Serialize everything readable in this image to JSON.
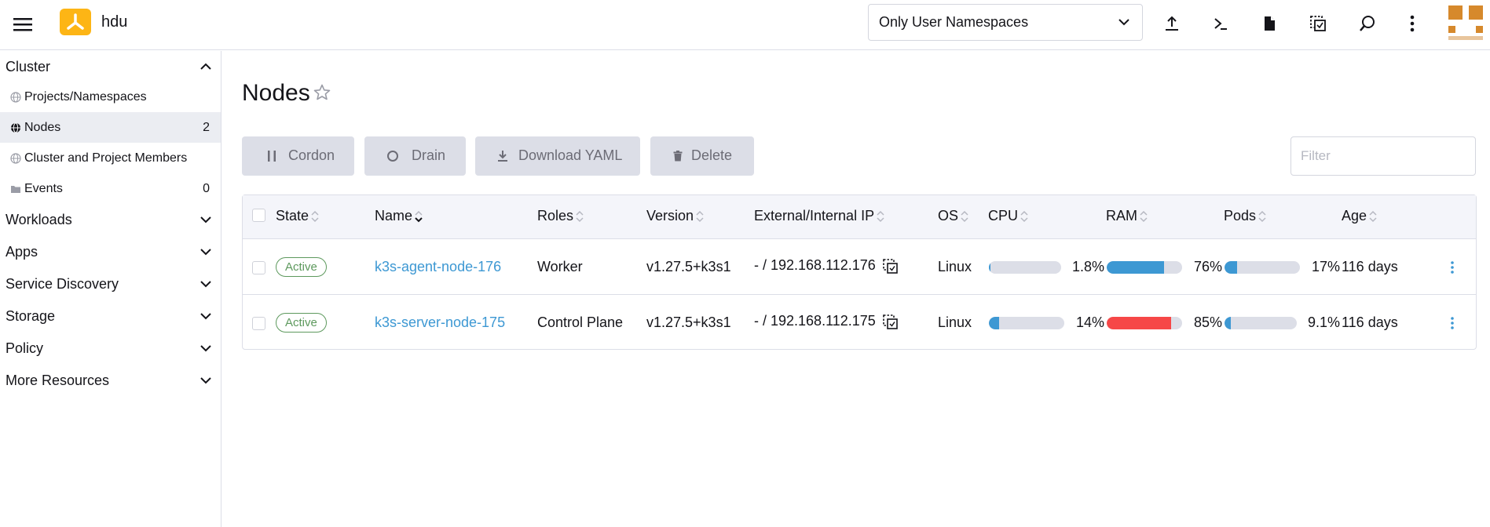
{
  "header": {
    "cluster_name": "hdu",
    "namespace_select": "Only User Namespaces"
  },
  "sidebar": {
    "groups": [
      {
        "label": "Cluster"
      },
      {
        "label": "Workloads"
      },
      {
        "label": "Apps"
      },
      {
        "label": "Service Discovery"
      },
      {
        "label": "Storage"
      },
      {
        "label": "Policy"
      },
      {
        "label": "More Resources"
      }
    ],
    "items": [
      {
        "label": "Projects/Namespaces",
        "count": ""
      },
      {
        "label": "Nodes",
        "count": "2"
      },
      {
        "label": "Cluster and Project Members",
        "count": ""
      },
      {
        "label": "Events",
        "count": "0"
      }
    ]
  },
  "page": {
    "title": "Nodes",
    "buttons": {
      "cordon": "Cordon",
      "drain": "Drain",
      "download": "Download YAML",
      "delete": "Delete"
    },
    "filter_placeholder": "Filter"
  },
  "table": {
    "columns": [
      "State",
      "Name",
      "Roles",
      "Version",
      "External/Internal IP",
      "OS",
      "CPU",
      "RAM",
      "Pods",
      "Age"
    ],
    "rows": [
      {
        "state": "Active",
        "name": "k3s-agent-node-176",
        "roles": "Worker",
        "version": "v1.27.5+k3s1",
        "ip": "- / 192.168.112.176",
        "os": "Linux",
        "cpu": "1.8%",
        "cpu_value": 1.8,
        "ram": "76%",
        "ram_value": 76,
        "pods": "17%",
        "pods_value": 17,
        "age": "116 days"
      },
      {
        "state": "Active",
        "name": "k3s-server-node-175",
        "roles": "Control Plane",
        "version": "v1.27.5+k3s1",
        "ip": "- / 192.168.112.175",
        "os": "Linux",
        "cpu": "14%",
        "cpu_value": 14,
        "ram": "85%",
        "ram_value": 85,
        "pods": "9.1%",
        "pods_value": 9.1,
        "age": "116 days"
      }
    ]
  },
  "colors": {
    "accent_blue": "#3d98d3",
    "danger_red": "#f64747",
    "active_green": "#5d995d",
    "logo_yellow": "#fdb515",
    "avatar_orange": "#d6892c"
  }
}
